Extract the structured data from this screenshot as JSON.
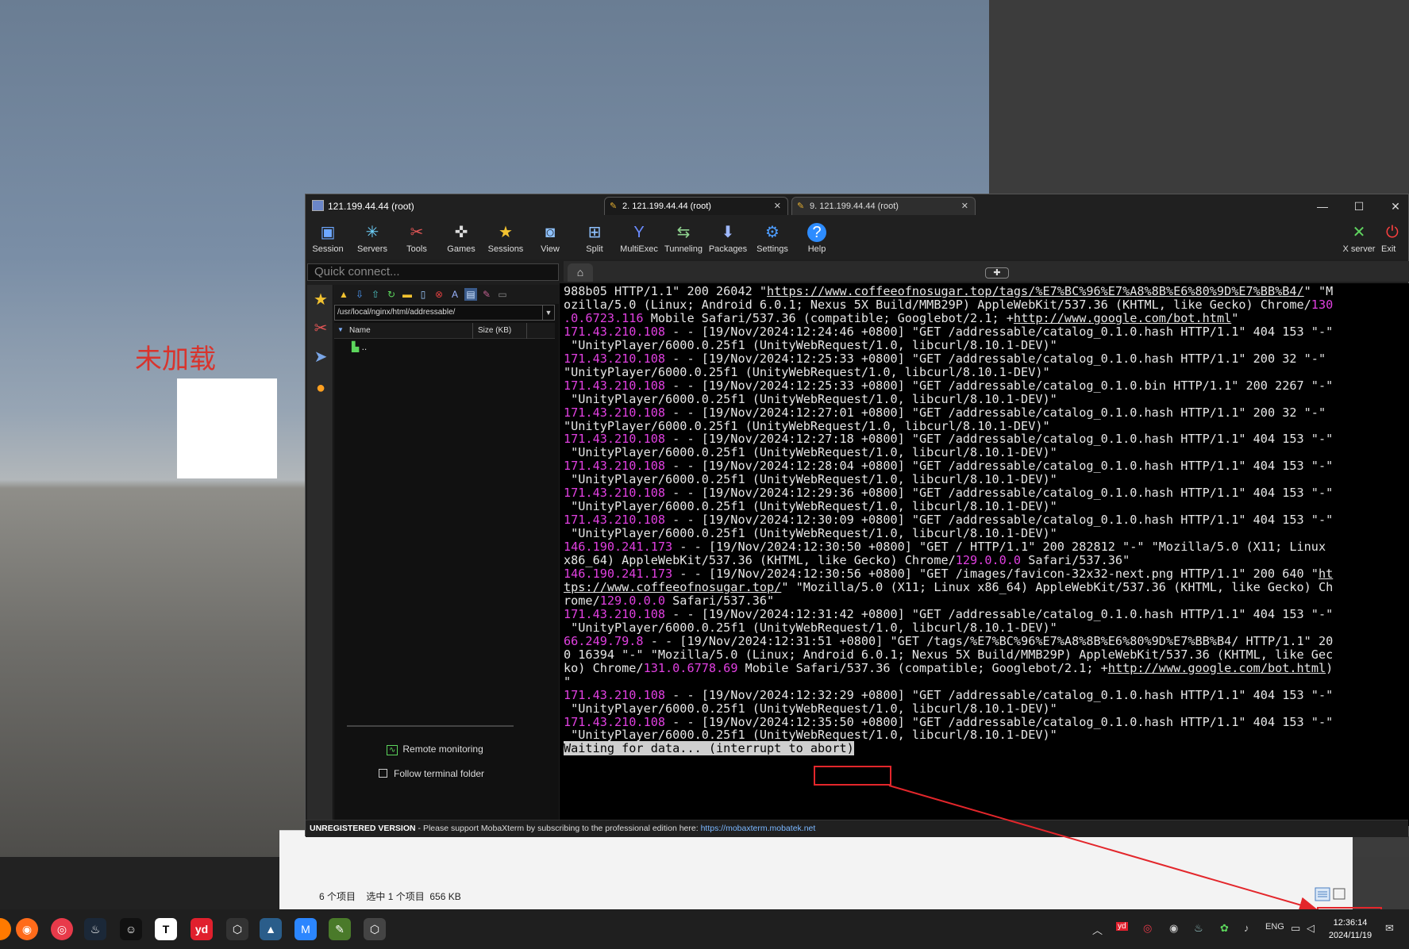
{
  "unity": {
    "label": "未加载"
  },
  "window": {
    "title": "121.199.44.44 (root)",
    "controls": {
      "minimize": "—",
      "maximize": "☐",
      "close": "✕"
    }
  },
  "toolbar": [
    {
      "label": "Session"
    },
    {
      "label": "Servers"
    },
    {
      "label": "Tools"
    },
    {
      "label": "Games"
    },
    {
      "label": "Sessions"
    },
    {
      "label": "View"
    },
    {
      "label": "Split"
    },
    {
      "label": "MultiExec"
    },
    {
      "label": "Tunneling"
    },
    {
      "label": "Packages"
    },
    {
      "label": "Settings"
    },
    {
      "label": "Help"
    }
  ],
  "toolbar_right": [
    {
      "label": "X server"
    },
    {
      "label": "Exit"
    }
  ],
  "quick_connect": {
    "placeholder": "Quick connect..."
  },
  "tabs": [
    {
      "label": "2. 121.199.44.44 (root)",
      "close": "✕"
    },
    {
      "label": "9. 121.199.44.44 (root)",
      "close": "✕"
    }
  ],
  "sftp": {
    "path": "/usr/local/nginx/html/addressable/",
    "columns": {
      "name": "Name",
      "size": "Size (KB)"
    },
    "parent": "..",
    "remote_monitoring": "Remote monitoring",
    "follow_folder": "Follow terminal folder"
  },
  "terminal": {
    "lines": [
      [
        [
          "988b05 HTTP/1.1\" 200 26042 \"",
          ""
        ],
        [
          "https://www.coffeeofnosugar.top/tags/%E7%BC%96%E7%A8%8B%E6%80%9D%E7%BB%B4/",
          "u"
        ],
        [
          "\" \"M",
          ""
        ]
      ],
      [
        [
          "ozilla/5.0 (Linux; Android 6.0.1; Nexus 5X Build/MMB29P) AppleWebKit/537.36 (KHTML, like Gecko) Chrome/",
          ""
        ],
        [
          "130",
          "mag"
        ]
      ],
      [
        [
          ".0.6723.116",
          "mag"
        ],
        [
          " Mobile Safari/537.36 (compatible; Googlebot/2.1; +",
          ""
        ],
        [
          "http://www.google.com/bot.html",
          "u"
        ],
        [
          "\"",
          ""
        ]
      ],
      [
        [
          "171.43.210.108",
          "ip"
        ],
        [
          " - - [19/Nov/2024:12:24:46 +0800] \"GET /addressable/catalog_0.1.0.hash HTTP/1.1\" 404 153 \"-\"",
          ""
        ]
      ],
      [
        [
          " \"UnityPlayer/6000.0.25f1 (UnityWebRequest/1.0, libcurl/8.10.1-DEV)\"",
          ""
        ]
      ],
      [
        [
          "171.43.210.108",
          "ip"
        ],
        [
          " - - [19/Nov/2024:12:25:33 +0800] \"GET /addressable/catalog_0.1.0.hash HTTP/1.1\" 200 32 \"-\"",
          ""
        ]
      ],
      [
        [
          "\"UnityPlayer/6000.0.25f1 (UnityWebRequest/1.0, libcurl/8.10.1-DEV)\"",
          ""
        ]
      ],
      [
        [
          "171.43.210.108",
          "ip"
        ],
        [
          " - - [19/Nov/2024:12:25:33 +0800] \"GET /addressable/catalog_0.1.0.bin HTTP/1.1\" 200 2267 \"-\"",
          ""
        ]
      ],
      [
        [
          " \"UnityPlayer/6000.0.25f1 (UnityWebRequest/1.0, libcurl/8.10.1-DEV)\"",
          ""
        ]
      ],
      [
        [
          "171.43.210.108",
          "ip"
        ],
        [
          " - - [19/Nov/2024:12:27:01 +0800] \"GET /addressable/catalog_0.1.0.hash HTTP/1.1\" 200 32 \"-\"",
          ""
        ]
      ],
      [
        [
          "\"UnityPlayer/6000.0.25f1 (UnityWebRequest/1.0, libcurl/8.10.1-DEV)\"",
          ""
        ]
      ],
      [
        [
          "171.43.210.108",
          "ip"
        ],
        [
          " - - [19/Nov/2024:12:27:18 +0800] \"GET /addressable/catalog_0.1.0.hash HTTP/1.1\" 404 153 \"-\"",
          ""
        ]
      ],
      [
        [
          " \"UnityPlayer/6000.0.25f1 (UnityWebRequest/1.0, libcurl/8.10.1-DEV)\"",
          ""
        ]
      ],
      [
        [
          "171.43.210.108",
          "ip"
        ],
        [
          " - - [19/Nov/2024:12:28:04 +0800] \"GET /addressable/catalog_0.1.0.hash HTTP/1.1\" 404 153 \"-\"",
          ""
        ]
      ],
      [
        [
          " \"UnityPlayer/6000.0.25f1 (UnityWebRequest/1.0, libcurl/8.10.1-DEV)\"",
          ""
        ]
      ],
      [
        [
          "171.43.210.108",
          "ip"
        ],
        [
          " - - [19/Nov/2024:12:29:36 +0800] \"GET /addressable/catalog_0.1.0.hash HTTP/1.1\" 404 153 \"-\"",
          ""
        ]
      ],
      [
        [
          " \"UnityPlayer/6000.0.25f1 (UnityWebRequest/1.0, libcurl/8.10.1-DEV)\"",
          ""
        ]
      ],
      [
        [
          "171.43.210.108",
          "ip"
        ],
        [
          " - - [19/Nov/2024:12:30:09 +0800] \"GET /addressable/catalog_0.1.0.hash HTTP/1.1\" 404 153 \"-\"",
          ""
        ]
      ],
      [
        [
          " \"UnityPlayer/6000.0.25f1 (UnityWebRequest/1.0, libcurl/8.10.1-DEV)\"",
          ""
        ]
      ],
      [
        [
          "146.190.241.173",
          "ip"
        ],
        [
          " - - [19/Nov/2024:12:30:50 +0800] \"GET / HTTP/1.1\" 200 282812 \"-\" \"Mozilla/5.0 (X11; Linux",
          ""
        ]
      ],
      [
        [
          "x86_64) AppleWebKit/537.36 (KHTML, like Gecko) Chrome/",
          ""
        ],
        [
          "129.0.0.0",
          "mag"
        ],
        [
          " Safari/537.36\"",
          ""
        ]
      ],
      [
        [
          "146.190.241.173",
          "ip"
        ],
        [
          " - - [19/Nov/2024:12:30:56 +0800] \"GET /images/favicon-32x32-next.png HTTP/1.1\" 200 640 \"",
          ""
        ],
        [
          "ht",
          "u"
        ]
      ],
      [
        [
          "tps://www.coffeeofnosugar.top/",
          "u"
        ],
        [
          "\" \"Mozilla/5.0 (X11; Linux x86_64) AppleWebKit/537.36 (KHTML, like Gecko) Ch",
          ""
        ]
      ],
      [
        [
          "rome/",
          ""
        ],
        [
          "129.0.0.0",
          "mag"
        ],
        [
          " Safari/537.36\"",
          ""
        ]
      ],
      [
        [
          "171.43.210.108",
          "ip"
        ],
        [
          " - - [19/Nov/2024:12:31:42 +0800] \"GET /addressable/catalog_0.1.0.hash HTTP/1.1\" 404 153 \"-\"",
          ""
        ]
      ],
      [
        [
          " \"UnityPlayer/6000.0.25f1 (UnityWebRequest/1.0, libcurl/8.10.1-DEV)\"",
          ""
        ]
      ],
      [
        [
          "66.249.79.8",
          "ip"
        ],
        [
          " - - [19/Nov/2024:12:31:51 +0800] \"GET /tags/%E7%BC%96%E7%A8%8B%E6%80%9D%E7%BB%B4/ HTTP/1.1\" 20",
          ""
        ]
      ],
      [
        [
          "0 16394 \"-\" \"Mozilla/5.0 (Linux; Android 6.0.1; Nexus 5X Build/MMB29P) AppleWebKit/537.36 (KHTML, like Gec",
          ""
        ]
      ],
      [
        [
          "ko) Chrome/",
          ""
        ],
        [
          "131.0.6778.69",
          "mag"
        ],
        [
          " Mobile Safari/537.36 (compatible; Googlebot/2.1; +",
          ""
        ],
        [
          "http://www.google.com/bot.html",
          "u"
        ],
        [
          ")",
          ""
        ]
      ],
      [
        [
          "\"",
          ""
        ]
      ],
      [
        [
          "171.43.210.108",
          "ip"
        ],
        [
          " - - [19/Nov/2024:12:32:29 +0800] \"GET /addressable/catalog_0.1.0.hash HTTP/1.1\" 404 153 \"-\"",
          ""
        ]
      ],
      [
        [
          " \"UnityPlayer/6000.0.25f1 (UnityWebRequest/1.0, libcurl/8.10.1-DEV)\"",
          ""
        ]
      ],
      [
        [
          "171.43.210.108",
          "ip"
        ],
        [
          " - - [19/Nov/2024:12:35:50 +0800] \"GET /addressable/catalog_0.1.0.hash HTTP/1.1\" 404 153 \"-\"",
          ""
        ]
      ],
      [
        [
          " \"UnityPlayer/6000.0.25f1 (UnityWebRequest/1.0, libcurl/8.10.1-DEV)\"",
          ""
        ]
      ],
      [
        [
          "Waiting for data... (interrupt to abort)",
          "wait"
        ]
      ]
    ]
  },
  "statusbar": {
    "unregistered": "UNREGISTERED VERSION",
    "message": " -  Please support MobaXterm by subscribing to the professional edition here: ",
    "link": "https://mobaxterm.mobatek.net"
  },
  "explorer": {
    "items": "6 个项目",
    "selected": "选中 1 个项目",
    "size": "656 KB"
  },
  "taskbar": {
    "tray_lang": "ENG",
    "time": "12:36:14",
    "date": "2024/11/19"
  }
}
